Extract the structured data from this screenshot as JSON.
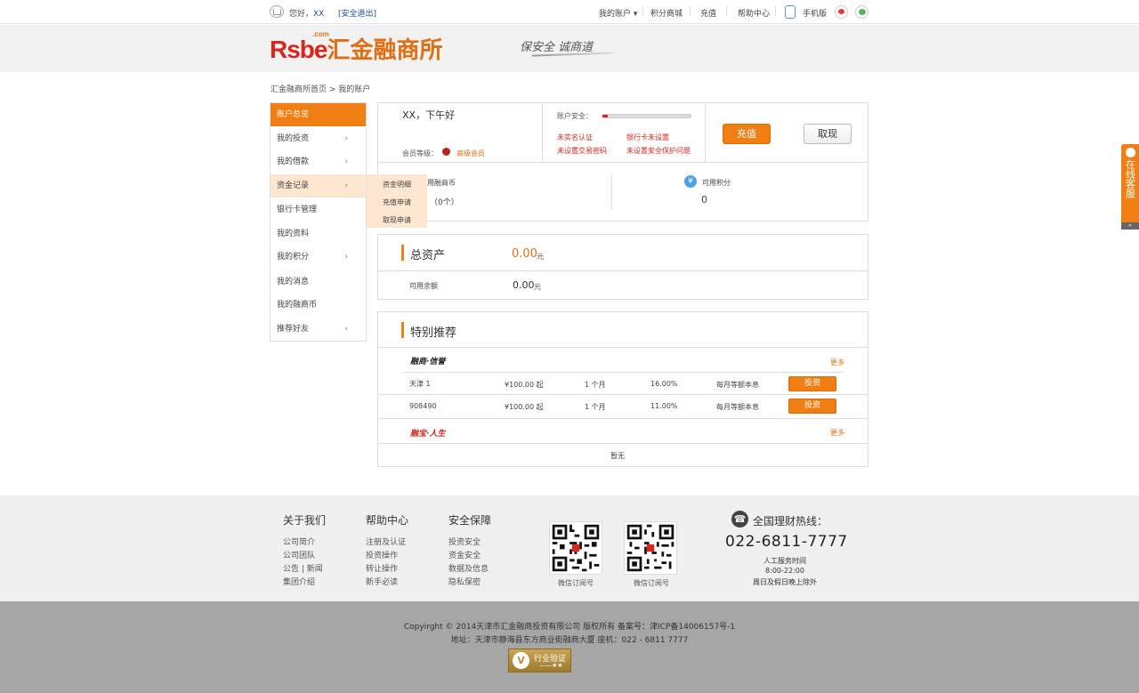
{
  "topbar": {
    "greeting": "您好，",
    "username": "XX",
    "logout": "[安全退出]",
    "my_account": "我的账户 ▾",
    "points_mall": "积分商城",
    "recharge": "充值",
    "help_center": "帮助中心",
    "mobile": "手机版"
  },
  "header": {
    "logo_latin": "Rsbe",
    "logo_com": ".com",
    "logo_cn": "汇金融商所",
    "slogan": "保安全  诚商道"
  },
  "breadcrumb": "汇金融商所首页 > 我的账户",
  "sidebar": {
    "items": [
      {
        "label": "账户总览",
        "arrow": ""
      },
      {
        "label": "我的投资",
        "arrow": "›"
      },
      {
        "label": "我的借款",
        "arrow": "›"
      },
      {
        "label": "资金记录",
        "arrow": "›"
      },
      {
        "label": "银行卡管理",
        "arrow": ""
      },
      {
        "label": "我的资料",
        "arrow": ""
      },
      {
        "label": "我的积分",
        "arrow": "›"
      },
      {
        "label": "我的消息",
        "arrow": ""
      },
      {
        "label": "我的融商币",
        "arrow": ""
      },
      {
        "label": "推荐好友",
        "arrow": "›"
      }
    ],
    "submenu": [
      "资金明细",
      "充值申请",
      "取现申请"
    ]
  },
  "account": {
    "greeting": "XX，下午好",
    "level_label": "会员等级：",
    "level_value": "高级会员",
    "security_label": "账户安全：",
    "security_level": 0.06,
    "security_links": [
      "未实名认证",
      "银行卡未设置",
      "未设置交易密码",
      "未设置安全保护问题"
    ],
    "recharge_button": "充值",
    "withdraw_button": "取现",
    "coin_label": "用融商币",
    "coin_value": "（0个）",
    "points_label": "可用积分",
    "points_value": "0",
    "points_icon": "yen-icon"
  },
  "assets": {
    "title": "总资产",
    "total": "0.00",
    "unit": "元",
    "balance_label": "可用余额",
    "balance": "0.00"
  },
  "recommend": {
    "title": "特别推荐",
    "brand1": "融商·信誉",
    "brand2": "融宝·人生",
    "more": "更多",
    "rows": [
      {
        "name": "天津 1",
        "amount": "¥100.00 起",
        "term": "1 个月",
        "rate": "16.00%",
        "method": "每月等额本息",
        "action": "投资"
      },
      {
        "name": "908490",
        "amount": "¥100.00 起",
        "term": "1 个月",
        "rate": "11.00%",
        "method": "每月等额本息",
        "action": "投资"
      }
    ],
    "empty": "暂无"
  },
  "service_tab": {
    "text": "在线客服",
    "close": "«"
  },
  "footer": {
    "about": {
      "title": "关于我们",
      "links": [
        "公司简介",
        "公司团队",
        "公告 | 新闻",
        "集团介绍"
      ]
    },
    "help": {
      "title": "帮助中心",
      "links": [
        "注册及认证",
        "投资操作",
        "转让操作",
        "新手必读"
      ]
    },
    "security": {
      "title": "安全保障",
      "links": [
        "投资安全",
        "资金安全",
        "数据及信息",
        "隐私保密"
      ]
    },
    "qr_labels": [
      "微信订阅号",
      "微信订阅号"
    ],
    "hotline_title": "全国理财热线：",
    "hotline": "022-6811-7777",
    "service_hours_label": "人工服务时间",
    "service_hours": "8:00-22:00",
    "service_note": "周日及假日晚上除外"
  },
  "copyright": {
    "line1": "Copyirght © 2014天津市汇金融商投资有限公司   版权所有  备案号：津ICP备14006157号-1",
    "line2": "地址：天津市静海县东方商业街融商大厦  座机：022 - 6811 7777",
    "badge_title": "行业验证",
    "badge_stars": "——★★"
  },
  "colors": {
    "accent": "#f07e12",
    "brand_red": "#d9261c",
    "link_blue": "#1d4fa3"
  }
}
